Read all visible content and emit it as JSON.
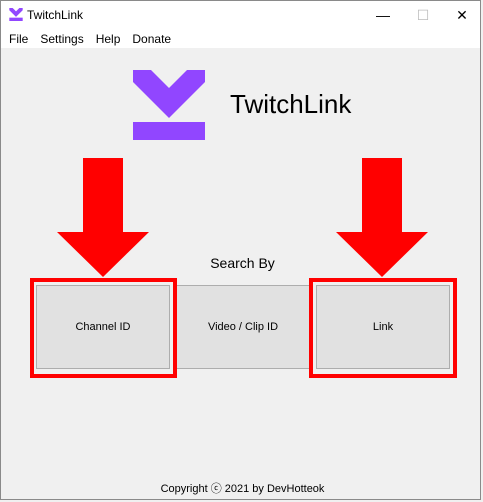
{
  "window": {
    "title": "TwitchLink",
    "minimize_glyph": "—",
    "maximize_glyph": "☐",
    "close_glyph": "✕"
  },
  "menu": {
    "items": [
      "File",
      "Settings",
      "Help",
      "Donate"
    ]
  },
  "header": {
    "app_name": "TwitchLink",
    "logo_color": "#9146ff"
  },
  "search": {
    "label": "Search By",
    "buttons": {
      "channel": "Channel ID",
      "video": "Video / Clip ID",
      "link": "Link"
    }
  },
  "annotations": {
    "color": "#ff0000",
    "highlighted": [
      "Channel ID",
      "Link"
    ]
  },
  "footer": {
    "copyright": "Copyright ⓒ 2021 by DevHotteok"
  }
}
